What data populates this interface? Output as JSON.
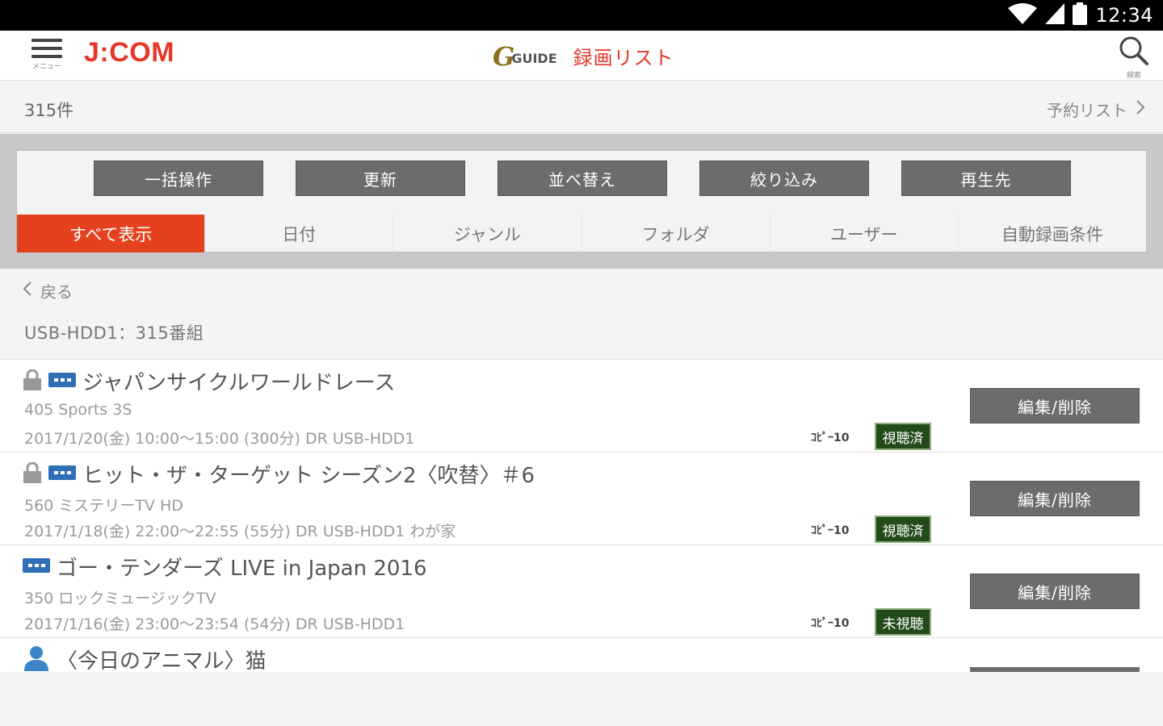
{
  "status_bar": {
    "time": "12:34"
  },
  "app_bar": {
    "menu_caption": "メニュー",
    "brand": "J:COM",
    "guide_logo_main": "G",
    "guide_logo_sub": "GUIDE",
    "title": "録画リスト",
    "search_caption": "検索"
  },
  "count_bar": {
    "count": "315件",
    "reserve_link": "予約リスト"
  },
  "actions": [
    {
      "label": "一括操作"
    },
    {
      "label": "更新"
    },
    {
      "label": "並べ替え"
    },
    {
      "label": "絞り込み"
    },
    {
      "label": "再生先"
    }
  ],
  "tabs": [
    {
      "label": "すべて表示",
      "active": true
    },
    {
      "label": "日付"
    },
    {
      "label": "ジャンル"
    },
    {
      "label": "フォルダ"
    },
    {
      "label": "ユーザー"
    },
    {
      "label": "自動録画条件"
    }
  ],
  "back_label": "戻る",
  "device_line": "USB-HDD1：315番組",
  "recordings": [
    {
      "title": "ジャパンサイクルワールドレース",
      "channel": "405 Sports 3S",
      "detail": "2017/1/20(金) 10:00〜15:00 (300分)  DR USB-HDD1",
      "copy": "ｺﾋﾟｰ10",
      "status": "視聴済",
      "edit_label": "編集/削除"
    },
    {
      "title": "ヒット・ザ・ターゲット シーズン2〈吹替〉＃6",
      "channel": "560 ミステリーTV HD",
      "detail": "2017/1/18(金) 22:00〜22:55 (55分)  DR USB-HDD1  わが家",
      "copy": "ｺﾋﾟｰ10",
      "status": "視聴済",
      "edit_label": "編集/削除"
    },
    {
      "title": "ゴー・テンダーズ LIVE in Japan 2016",
      "channel": "350  ロックミュージックTV",
      "detail": "2017/1/16(金) 23:00〜23:54 (54分)  DR USB-HDD1",
      "copy": "ｺﾋﾟｰ10",
      "status": "未視聴",
      "edit_label": "編集/削除"
    },
    {
      "title": "〈今日のアニマル〉猫"
    }
  ],
  "colors": {
    "accent": "#e6372a",
    "active_tab": "#e5411f",
    "button": "#6c6c6c",
    "badge": "#234a19"
  }
}
